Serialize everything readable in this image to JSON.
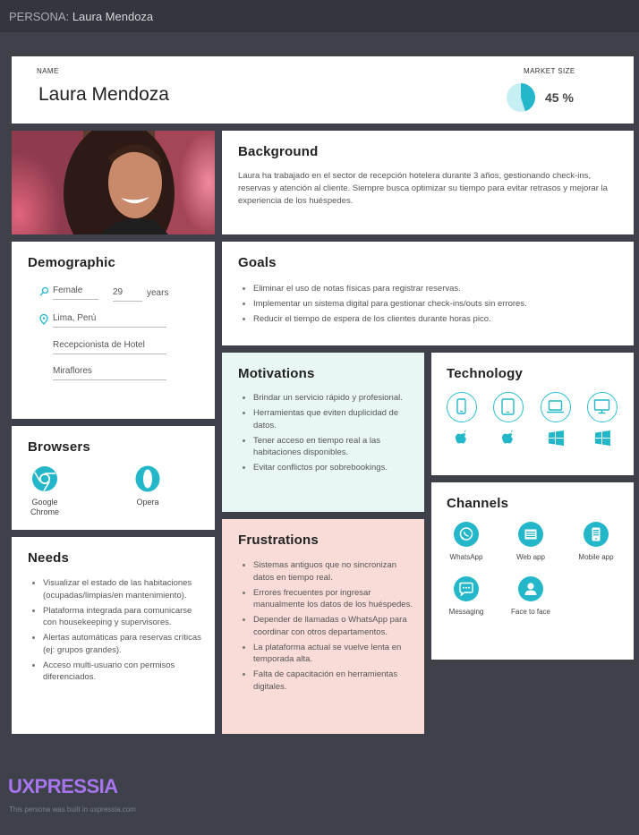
{
  "header": {
    "prefix": "PERSONA:",
    "name": "Laura Mendoza"
  },
  "profile": {
    "name_label": "NAME",
    "name": "Laura Mendoza",
    "market_label": "MARKET SIZE",
    "market_value": "45 %",
    "market_fraction": 0.45
  },
  "background": {
    "title": "Background",
    "text": "Laura ha trabajado en el sector de recepción hotelera durante 3 años, gestionando check-ins, reservas y atención al cliente. Siempre busca optimizar su tiempo para evitar retrasos y mejorar la experiencia de los huéspedes."
  },
  "demographic": {
    "title": "Demographic",
    "gender": "Female",
    "age": "29",
    "age_unit": "years",
    "location": "Lima, Perú",
    "occupation": "Recepcionista de Hotel",
    "district": "Miraflores"
  },
  "goals": {
    "title": "Goals",
    "items": [
      "Eliminar el uso de notas físicas para registrar reservas.",
      "Implementar un sistema digital para gestionar check-ins/outs sin errores.",
      "Reducir el tiempo de espera de los clientes durante horas pico."
    ]
  },
  "motivations": {
    "title": "Motivations",
    "items": [
      "Brindar un servicio rápido y profesional.",
      "Herramientas que eviten duplicidad de datos.",
      "Tener acceso en tiempo real a las habitaciones disponibles.",
      "Evitar conflictos por sobrebookings."
    ]
  },
  "technology": {
    "title": "Technology",
    "devices": [
      "smartphone-icon",
      "tablet-icon",
      "laptop-icon",
      "desktop-icon"
    ],
    "os": [
      "apple-icon",
      "apple-icon",
      "windows-icon",
      "windows-icon"
    ]
  },
  "browsers": {
    "title": "Browsers",
    "items": [
      {
        "label1": "Google",
        "label2": "Chrome",
        "icon": "chrome-icon"
      },
      {
        "label1": "Opera",
        "label2": "",
        "icon": "opera-icon"
      }
    ]
  },
  "channels": {
    "title": "Channels",
    "items": [
      {
        "label": "WhatsApp",
        "icon": "whatsapp-icon"
      },
      {
        "label": "Web app",
        "icon": "web-app-icon"
      },
      {
        "label": "Mobile app",
        "icon": "mobile-app-icon"
      },
      {
        "label": "Messaging",
        "icon": "messaging-icon"
      },
      {
        "label": "Face to face",
        "icon": "face-to-face-icon"
      }
    ]
  },
  "needs": {
    "title": "Needs",
    "items": [
      "Visualizar el estado de las habitaciones (ocupadas/limpias/en mantenimiento).",
      "Plataforma integrada para comunicarse con housekeeping y supervisores.",
      "Alertas automáticas para reservas críticas (ej: grupos grandes).",
      "Acceso multi-usuario con permisos diferenciados."
    ]
  },
  "frustrations": {
    "title": "Frustrations",
    "items": [
      "Sistemas antiguos que no sincronizan datos en tiempo real.",
      "Errores frecuentes por ingresar manualmente los datos de los huéspedes.",
      "Depender de llamadas o WhatsApp para coordinar con otros departamentos.",
      "La plataforma actual se vuelve lenta en temporada alta.",
      "Falta de capacitación en herramientas digitales."
    ]
  },
  "footer": {
    "brand": "UXPRESSIA",
    "note": "This persona was built in uxpressia.com"
  },
  "colors": {
    "teal": "#24b7c9",
    "motivations_bg": "#e8f7f4",
    "frustrations_bg": "#f9dcd8",
    "brand": "#a775f0"
  }
}
